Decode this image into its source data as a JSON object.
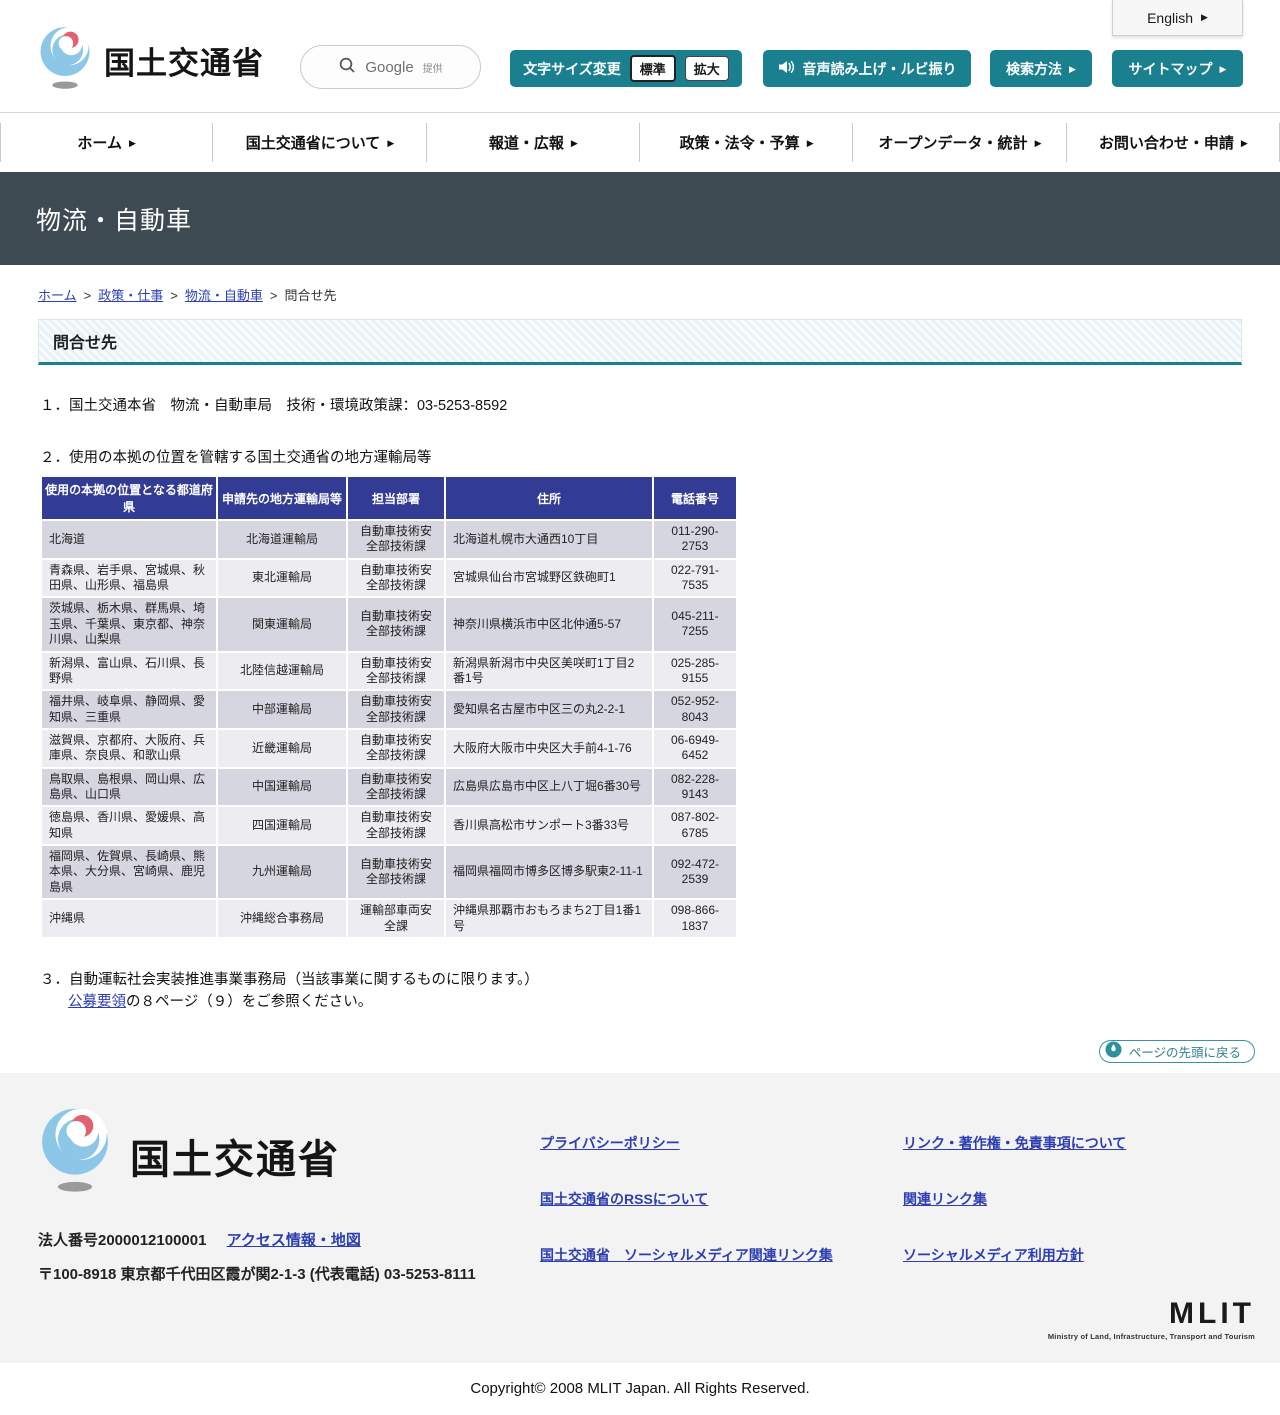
{
  "icons": {
    "arrow_right": "▶"
  },
  "header": {
    "brand": "国土交通省",
    "english": "English",
    "search": {
      "provider": "Google",
      "provider_suffix": "提供"
    },
    "buttons": {
      "font_size_label": "文字サイズ変更",
      "font_size_standard": "標準",
      "font_size_large": "拡大",
      "tts": "音声読み上げ・ルビ振り",
      "search_method": "検索方法",
      "sitemap": "サイトマップ"
    }
  },
  "nav": {
    "items": [
      "ホーム",
      "国土交通省について",
      "報道・広報",
      "政策・法令・予算",
      "オープンデータ・統計",
      "お問い合わせ・申請"
    ]
  },
  "page": {
    "title": "物流・自動車"
  },
  "breadcrumb": {
    "items": [
      "ホーム",
      "政策・仕事",
      "物流・自動車",
      "問合せ先"
    ]
  },
  "section": {
    "heading": "問合せ先"
  },
  "content": {
    "item1": "１．国土交通本省　物流・自動車局　技術・環境政策課：03-5253-8592",
    "item2": "２．使用の本拠の位置を管轄する国土交通省の地方運輸局等",
    "item3_line1": "３．自動運転社会実装推進事業事務局（当該事業に関するものに限ります。）",
    "item3_link": "公募要領",
    "item3_line2_rest": "の８ページ（９）をご参照ください。"
  },
  "table": {
    "headers": [
      "使用の本拠の位置となる都道府県",
      "申請先の地方運輸局等",
      "担当部署",
      "住所",
      "電話番号"
    ],
    "rows": [
      [
        "北海道",
        "北海道運輸局",
        "自動車技術安全部技術課",
        "北海道札幌市大通西10丁目",
        "011-290-2753"
      ],
      [
        "青森県、岩手県、宮城県、秋田県、山形県、福島県",
        "東北運輸局",
        "自動車技術安全部技術課",
        "宮城県仙台市宮城野区鉄砲町1",
        "022-791-7535"
      ],
      [
        "茨城県、栃木県、群馬県、埼玉県、千葉県、東京都、神奈川県、山梨県",
        "関東運輸局",
        "自動車技術安全部技術課",
        "神奈川県横浜市中区北仲通5-57",
        "045-211-7255"
      ],
      [
        "新潟県、富山県、石川県、長野県",
        "北陸信越運輸局",
        "自動車技術安全部技術課",
        "新潟県新潟市中央区美咲町1丁目2番1号",
        "025-285-9155"
      ],
      [
        "福井県、岐阜県、静岡県、愛知県、三重県",
        "中部運輸局",
        "自動車技術安全部技術課",
        "愛知県名古屋市中区三の丸2-2-1",
        "052-952-8043"
      ],
      [
        "滋賀県、京都府、大阪府、兵庫県、奈良県、和歌山県",
        "近畿運輸局",
        "自動車技術安全部技術課",
        "大阪府大阪市中央区大手前4-1-76",
        "06-6949-6452"
      ],
      [
        "鳥取県、島根県、岡山県、広島県、山口県",
        "中国運輸局",
        "自動車技術安全部技術課",
        "広島県広島市中区上八丁堀6番30号",
        "082-228-9143"
      ],
      [
        "徳島県、香川県、愛媛県、高知県",
        "四国運輸局",
        "自動車技術安全部技術課",
        "香川県高松市サンポート3番33号",
        "087-802-6785"
      ],
      [
        "福岡県、佐賀県、長崎県、熊本県、大分県、宮崎県、鹿児島県",
        "九州運輸局",
        "自動車技術安全部技術課",
        "福岡県福岡市博多区博多駅東2-11-1",
        "092-472-2539"
      ],
      [
        "沖縄県",
        "沖縄総合事務局",
        "運輸部車両安全課",
        "沖縄県那覇市おもろまち2丁目1番1号",
        "098-866-1837"
      ]
    ]
  },
  "back_to_top": {
    "label": "ページの先頭に戻る"
  },
  "footer": {
    "brand": "国土交通省",
    "corporate_number": "法人番号2000012100001",
    "access_link": "アクセス情報・地図",
    "address": "〒100-8918 東京都千代田区霞が関2-1-3 (代表電話) 03-5253-8111",
    "links_col1": [
      "プライバシーポリシー",
      "国土交通省のRSSについて",
      "国土交通省　ソーシャルメディア関連リンク集"
    ],
    "links_col2": [
      "リンク・著作権・免責事項について",
      "関連リンク集",
      "ソーシャルメディア利用方針"
    ],
    "mlit_logo": "MLIT",
    "mlit_tagline": "Ministry of Land, Infrastructure, Transport and Tourism"
  },
  "copyright": "Copyright© 2008 MLIT Japan. All Rights Reserved.",
  "colors": {
    "teal": "#1a7f8e",
    "table_header_navy": "#333c94",
    "title_band": "#3e4a52",
    "link_blue": "#2d3fb0"
  }
}
